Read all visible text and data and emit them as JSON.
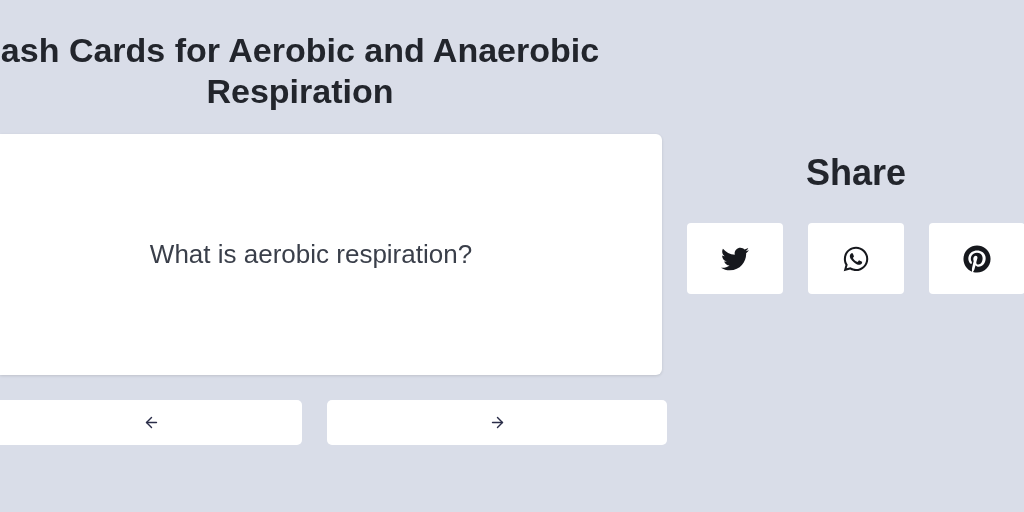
{
  "title": "ash Cards for Aerobic and Anaerobic Respiration",
  "card": {
    "question": "What is aerobic respiration?"
  },
  "navigation": [
    {
      "kind": "previous"
    },
    {
      "kind": "next"
    }
  ],
  "share": {
    "heading": "Share",
    "buttons": [
      {
        "kind": "twitter"
      },
      {
        "kind": "whatsapp"
      },
      {
        "kind": "pinterest"
      }
    ]
  }
}
